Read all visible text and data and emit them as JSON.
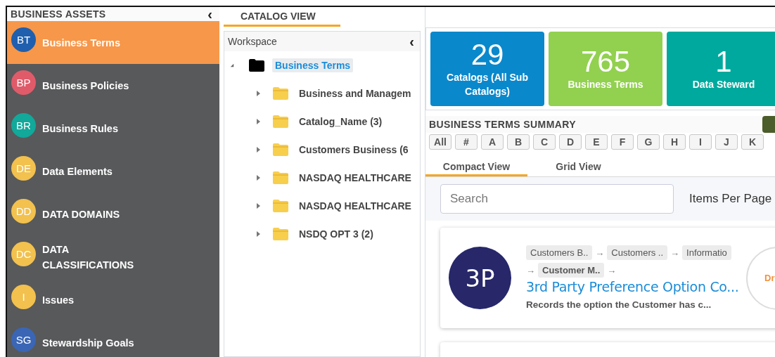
{
  "sidebar": {
    "title": "BUSINESS ASSETS",
    "collapse_glyph": "‹",
    "items": [
      {
        "initials": "BT",
        "label": "Business Terms",
        "color": "#1f5fae",
        "selected": true
      },
      {
        "initials": "BP",
        "label": "Business Policies",
        "color": "#e05b6a",
        "selected": false
      },
      {
        "initials": "BR",
        "label": "Business Rules",
        "color": "#12a89a",
        "selected": false
      },
      {
        "initials": "DE",
        "label": "Data Elements",
        "color": "#f2c14e",
        "selected": false
      },
      {
        "initials": "DD",
        "label": "DATA DOMAINS",
        "color": "#f2c14e",
        "selected": false
      },
      {
        "initials": "DC",
        "label": "DATA CLASSIFICATIONS",
        "color": "#f2c14e",
        "selected": false
      },
      {
        "initials": "I",
        "label": "Issues",
        "color": "#f2c14e",
        "selected": false
      },
      {
        "initials": "SG",
        "label": "Stewardship Goals",
        "color": "#3b66b5",
        "selected": false
      }
    ]
  },
  "main_tab": {
    "label": "CATALOG VIEW",
    "selected": true
  },
  "workspace": {
    "title": "Workspace",
    "collapse_glyph": "‹",
    "tree": [
      {
        "label": "Business Terms",
        "expanded": true,
        "selected": true,
        "children": [
          {
            "label": "Business and Managem",
            "expanded": false,
            "selected": false
          },
          {
            "label": "Catalog_Name (3)",
            "expanded": false,
            "selected": false
          },
          {
            "label": "Customers Business (6",
            "expanded": false,
            "selected": false
          },
          {
            "label": "NASDAQ HEALTHCARE",
            "expanded": false,
            "selected": false
          },
          {
            "label": "NASDAQ HEALTHCARE",
            "expanded": false,
            "selected": false
          },
          {
            "label": "NSDQ OPT 3 (2)",
            "expanded": false,
            "selected": false
          }
        ]
      }
    ]
  },
  "tiles": [
    {
      "value": "29",
      "label": "Catalogs (All Sub Catalogs)",
      "color": "#0a88cc"
    },
    {
      "value": "765",
      "label": "Business Terms",
      "color": "#92d050"
    },
    {
      "value": "1",
      "label": "Data Steward",
      "color": "#00a99d"
    }
  ],
  "summary": {
    "title": "BUSINESS TERMS SUMMARY",
    "letters": [
      "All",
      "#",
      "A",
      "B",
      "C",
      "D",
      "E",
      "F",
      "G",
      "H",
      "I",
      "J",
      "K"
    ],
    "view_tabs": [
      {
        "label": "Compact View",
        "selected": true
      },
      {
        "label": "Grid View",
        "selected": false
      }
    ],
    "search": {
      "placeholder": "Search"
    },
    "items_per_page_label": "Items Per Page",
    "cards": [
      {
        "initials": "3P",
        "separator": "→",
        "breadcrumbs": [
          {
            "label": "Customers B..",
            "current": false
          },
          {
            "label": "Customers ..",
            "current": false
          },
          {
            "label": "Informatio",
            "current": false
          },
          {
            "label": "Customer M..",
            "current": true
          }
        ],
        "title": "3rd Party Preference Option Co...",
        "description": "Records the option the Customer has c...",
        "status": "Dr"
      }
    ]
  }
}
